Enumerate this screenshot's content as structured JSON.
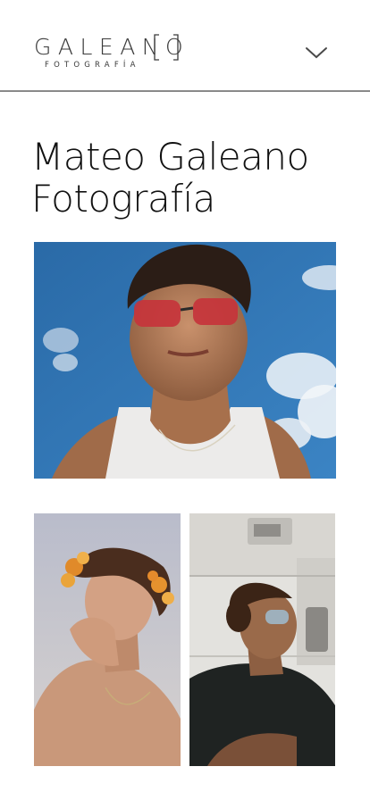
{
  "header": {
    "logo": {
      "main": "GALEANO",
      "sub": "FOTOGRAFÍA"
    },
    "menu_icon": "chevron-down-icon"
  },
  "page": {
    "title_line1": "Mateo Galeano",
    "title_line2": "Fotografía"
  },
  "gallery": {
    "photos": [
      {
        "name": "portrait-red-sunglasses-sky"
      },
      {
        "name": "portrait-flower-crown"
      },
      {
        "name": "portrait-laundromat-sunglasses"
      }
    ]
  },
  "colors": {
    "text": "#111111",
    "logo": "#3a3a3a",
    "divider": "#8a8a8a",
    "sky": "#2f6fa8"
  }
}
